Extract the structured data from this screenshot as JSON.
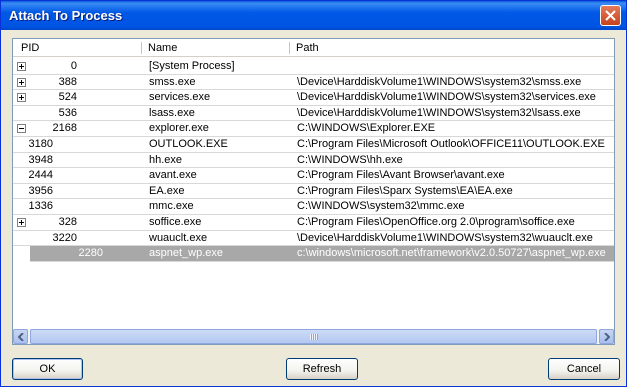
{
  "window": {
    "title": "Attach To Process"
  },
  "list": {
    "columns": [
      "PID",
      "Name",
      "Path"
    ],
    "rows": [
      {
        "pid": "0",
        "name": "[System Process]",
        "path": "",
        "expander": "plus",
        "level": 0
      },
      {
        "pid": "388",
        "name": "smss.exe",
        "path": "\\Device\\HarddiskVolume1\\WINDOWS\\system32\\smss.exe",
        "expander": "plus",
        "level": 0
      },
      {
        "pid": "524",
        "name": "services.exe",
        "path": "\\Device\\HarddiskVolume1\\WINDOWS\\system32\\services.exe",
        "expander": "plus",
        "level": 0
      },
      {
        "pid": "536",
        "name": "lsass.exe",
        "path": "\\Device\\HarddiskVolume1\\WINDOWS\\system32\\lsass.exe",
        "expander": "",
        "level": 0
      },
      {
        "pid": "2168",
        "name": "explorer.exe",
        "path": "C:\\WINDOWS\\Explorer.EXE",
        "expander": "minus",
        "level": 0
      },
      {
        "pid": "3180",
        "name": "OUTLOOK.EXE",
        "path": "C:\\Program Files\\Microsoft Outlook\\OFFICE11\\OUTLOOK.EXE",
        "expander": "",
        "level": 1
      },
      {
        "pid": "3948",
        "name": "hh.exe",
        "path": "C:\\WINDOWS\\hh.exe",
        "expander": "",
        "level": 1
      },
      {
        "pid": "2444",
        "name": "avant.exe",
        "path": "C:\\Program Files\\Avant Browser\\avant.exe",
        "expander": "",
        "level": 1
      },
      {
        "pid": "3956",
        "name": "EA.exe",
        "path": "C:\\Program Files\\Sparx Systems\\EA\\EA.exe",
        "expander": "",
        "level": 1
      },
      {
        "pid": "1336",
        "name": "mmc.exe",
        "path": "C:\\WINDOWS\\system32\\mmc.exe",
        "expander": "",
        "level": 1
      },
      {
        "pid": "328",
        "name": "soffice.exe",
        "path": "C:\\Program Files\\OpenOffice.org 2.0\\program\\soffice.exe",
        "expander": "plus",
        "level": 0
      },
      {
        "pid": "3220",
        "name": "wuauclt.exe",
        "path": "\\Device\\HarddiskVolume1\\WINDOWS\\system32\\wuauclt.exe",
        "expander": "",
        "level": 0
      },
      {
        "pid": "2280",
        "name": "aspnet_wp.exe",
        "path": "c:\\windows\\microsoft.net\\framework\\v2.0.50727\\aspnet_wp.exe",
        "expander": "",
        "level": 0,
        "selected": true
      }
    ]
  },
  "buttons": {
    "ok": "OK",
    "refresh": "Refresh",
    "cancel": "Cancel"
  },
  "colors": {
    "titlebar": "#0054e3",
    "selection": "#a8a8a8",
    "dialog_bg": "#ece9d8"
  },
  "icons": {
    "close": "close-icon",
    "expand": "plus-box-icon",
    "collapse": "minus-box-icon"
  }
}
